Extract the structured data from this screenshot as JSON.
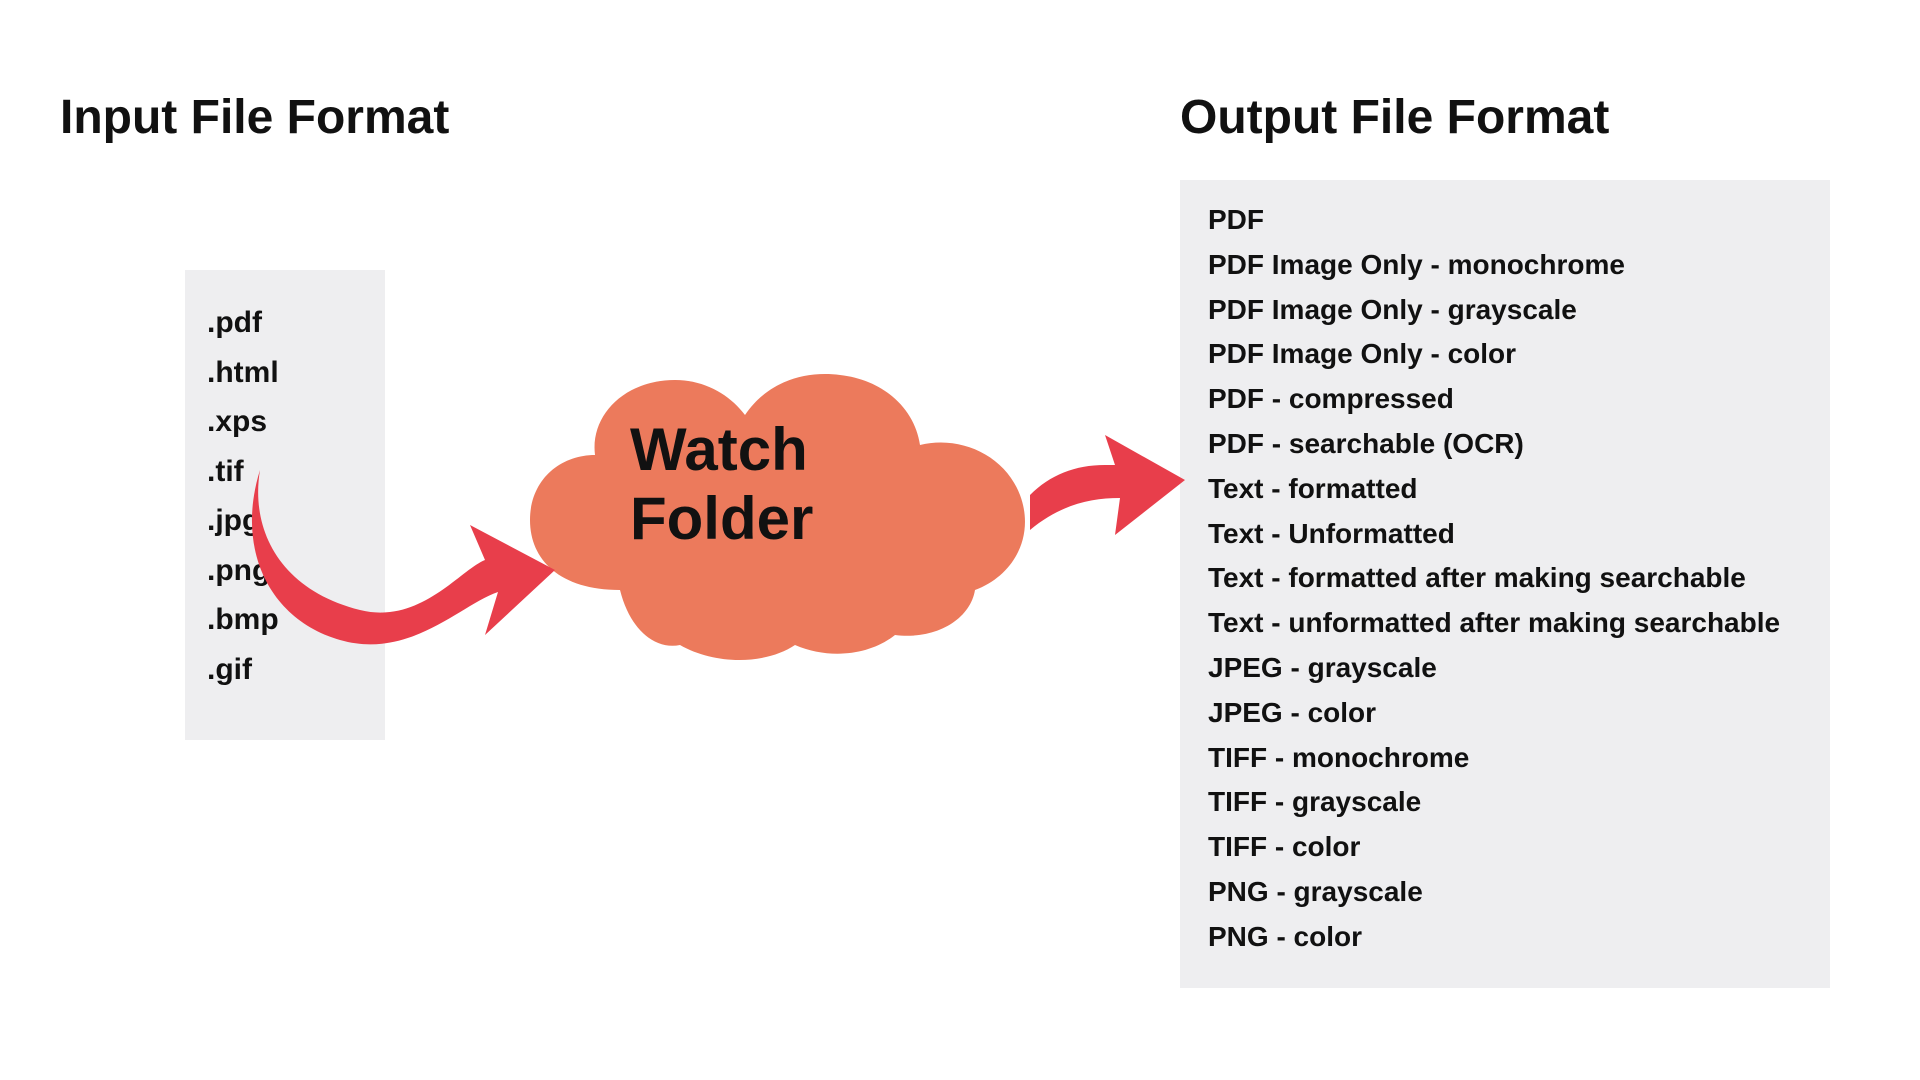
{
  "headings": {
    "input": "Input File Format",
    "output": "Output File Format"
  },
  "center": {
    "label_line1": "Watch",
    "label_line2": "Folder"
  },
  "input_formats": [
    ".pdf",
    ".html",
    ".xps",
    ".tif",
    ".jpg",
    ".png",
    ".bmp",
    ".gif"
  ],
  "output_formats": [
    "PDF",
    "PDF Image Only - monochrome",
    "PDF Image Only - grayscale",
    "PDF Image Only - color",
    "PDF - compressed",
    "PDF - searchable (OCR)",
    "Text - formatted",
    "Text - Unformatted",
    "Text - formatted after making searchable",
    "Text - unformatted after making searchable",
    "JPEG - grayscale",
    "JPEG - color",
    "TIFF - monochrome",
    "TIFF - grayscale",
    "TIFF - color",
    "PNG - grayscale",
    "PNG - color"
  ],
  "colors": {
    "cloud_fill": "#ec7a5c",
    "arrow_fill": "#e83e4b",
    "panel_bg": "#eeeef0",
    "text": "#111111"
  }
}
